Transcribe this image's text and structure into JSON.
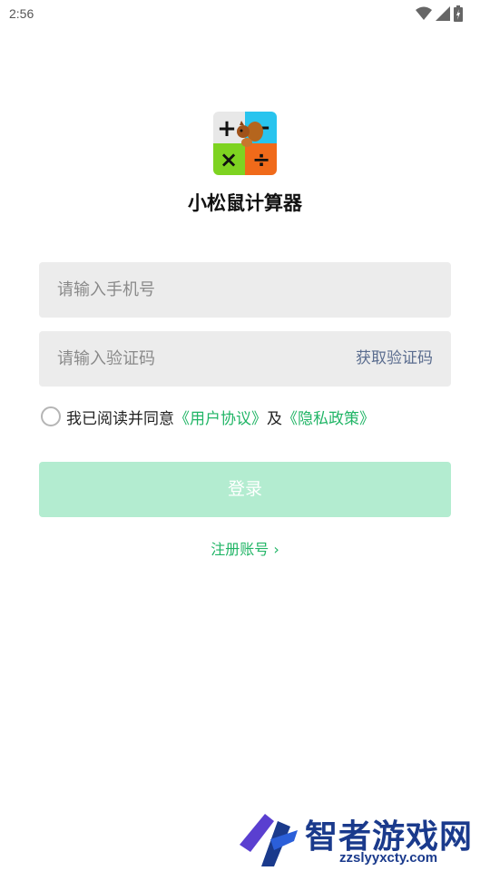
{
  "status_bar": {
    "time": "2:56",
    "icons": [
      "wifi-icon",
      "cell-signal-icon",
      "battery-icon"
    ]
  },
  "app": {
    "name": "小松鼠计算器",
    "logo_symbols": [
      "+",
      "−",
      "×",
      "÷"
    ]
  },
  "form": {
    "phone_placeholder": "请输入手机号",
    "code_placeholder": "请输入验证码",
    "get_code_label": "获取验证码"
  },
  "agreement": {
    "prefix": "我已阅读并同意",
    "user_agreement": "《用户协议》",
    "conjunction": "及",
    "privacy_policy": "《隐私政策》",
    "checked": false
  },
  "login_label": "登录",
  "register_label": "注册账号 ›",
  "watermark": {
    "brand": "智者游戏网",
    "url": "zzslyyxcty.com"
  },
  "colors": {
    "accent": "#21b566",
    "login_disabled": "#b3ecd0",
    "field_bg": "#ececec",
    "get_code": "#5b6d8f"
  }
}
